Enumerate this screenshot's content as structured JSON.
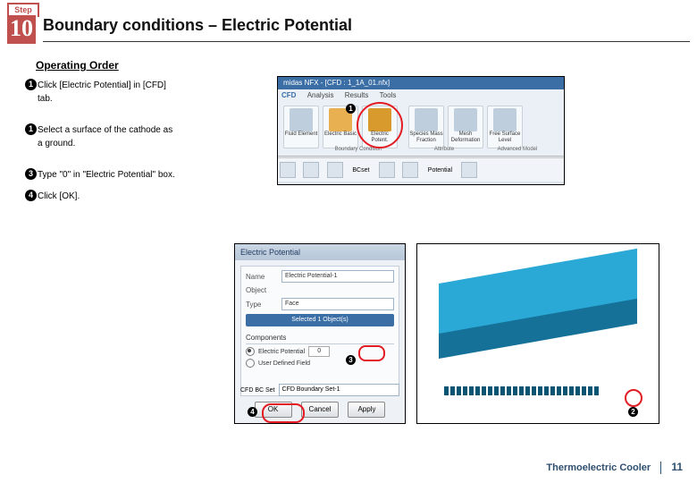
{
  "step": {
    "label": "Step",
    "number": "10"
  },
  "title": "Boundary conditions – Electric Potential",
  "section_label": "Operating Order",
  "instructions": [
    {
      "n": "1",
      "line1": "Click [Electric Potential] in [CFD]",
      "line2": "tab."
    },
    {
      "n": "1",
      "line1": "Select a surface of the cathode as",
      "line2": "a ground."
    },
    {
      "n": "3",
      "line1": "Type \"0\" in \"Electric Potential\" box.",
      "line2": ""
    },
    {
      "n": "4",
      "line1": "Click [OK].",
      "line2": ""
    }
  ],
  "ribbon": {
    "window_title": "midas NFX - [CFD : 1_1A_01.nfx]",
    "tabs": [
      "CFD",
      "Analysis",
      "Results",
      "Tools"
    ],
    "active_tab": "CFD",
    "buttons": {
      "fluid": "Fluid Element",
      "electric_basic": "Electric Basic",
      "electric_pot": "Electric Potent.",
      "species": "Species Mass Fraction",
      "mesh_def": "Mesh Deformation",
      "free_surf": "Free Surface Level"
    },
    "groups": {
      "bc": "Boundary Condition",
      "attr": "Attribute",
      "adv": "Advanced Model"
    },
    "qat": {
      "bcset": "BCset",
      "potential": "Potential"
    }
  },
  "dialog": {
    "title": "Electric Potential",
    "fields": {
      "name_label": "Name",
      "name_val": "Electric Potential-1",
      "object_label": "Object",
      "type_label": "Type",
      "type_val": "Face",
      "selected": "Selected 1 Object(s)"
    },
    "components_label": "Components",
    "opt_ep": "Electric Potential",
    "opt_ep_val": "0",
    "opt_udf": "User Defined Field",
    "bcset_label": "CFD BC Set",
    "bcset_val": "CFD Boundary Set-1",
    "buttons": {
      "ok": "OK",
      "cancel": "Cancel",
      "apply": "Apply"
    }
  },
  "markers": {
    "m1": "1",
    "m2": "2",
    "m3": "3",
    "m4": "4"
  },
  "footer": {
    "project": "Thermoelectric Cooler",
    "page": "11"
  }
}
